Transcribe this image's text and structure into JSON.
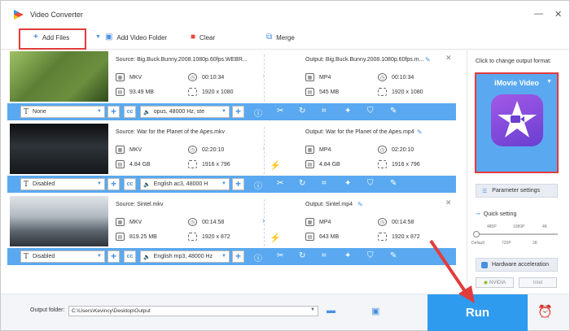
{
  "window": {
    "title": "Video Converter",
    "minimize": "—",
    "close": "✕"
  },
  "toolbar": {
    "add_files": "Add Files",
    "add_video_folder": "Add Video Folder",
    "clear": "Clear",
    "merge": "Merge"
  },
  "items": [
    {
      "source": "Source: Big.Buck.Bunny.2008.1080p.60fps.WEBR...",
      "output": "Output: Big.Buck.Bunny.2008.1080p.60fps.m...",
      "src_format": "MKV",
      "src_duration": "00:10:34",
      "src_size": "93.49 MB",
      "src_resolution": "1920 x 1080",
      "out_format": "MP4",
      "out_duration": "00:10:34",
      "out_size": "545 MB",
      "out_resolution": "1920 x 1080",
      "subtitle": "None",
      "audio": "opus, 48000 Hz, ste",
      "thumb_colors": [
        "#7a9c4a",
        "#3c5a28"
      ]
    },
    {
      "source": "Source: War for the Planet of the Apes.mkv",
      "output": "Output: War for the Planet of the Apes.mp4",
      "src_format": "MKV",
      "src_duration": "02:20:10",
      "src_size": "4.84 GB",
      "src_resolution": "1916 x 796",
      "out_format": "MP4",
      "out_duration": "02:20:10",
      "out_size": "4.84 GB",
      "out_resolution": "1916 x 796",
      "subtitle": "Disabled",
      "audio": "English ac3, 48000 H",
      "thumb_colors": [
        "#1a1e22",
        "#3a4148"
      ]
    },
    {
      "source": "Source: Sintel.mkv",
      "output": "Output: Sintel.mp4",
      "src_format": "MKV",
      "src_duration": "00:14:58",
      "src_size": "819.25 MB",
      "src_resolution": "1920 x 872",
      "out_format": "MP4",
      "out_duration": "00:14:58",
      "out_size": "643 MB",
      "out_resolution": "1920 x 872",
      "subtitle": "Disabled",
      "audio": "English mp3, 48000 Hz",
      "thumb_colors": [
        "#c9d0d6",
        "#5d6670"
      ]
    }
  ],
  "right_panel": {
    "caption": "Click to change output format:",
    "format": "iMovie Video",
    "parameter_settings": "Parameter settings",
    "quick_setting": "Quick setting",
    "ticks_top": [
      "480P",
      "1080P",
      "4K"
    ],
    "ticks_bottom": [
      "Default",
      "720P",
      "2K"
    ],
    "hardware_acceleration": "Hardware acceleration",
    "nvidia": "NVIDIA",
    "intel": "Intel"
  },
  "bottom": {
    "output_folder_label": "Output folder:",
    "output_folder_value": "C:\\Users\\Kevincy\\Desktop\\Output",
    "run": "Run"
  },
  "colors": {
    "accent": "#5aa9f0",
    "run": "#2f9bef",
    "highlight": "#e23c3c"
  }
}
